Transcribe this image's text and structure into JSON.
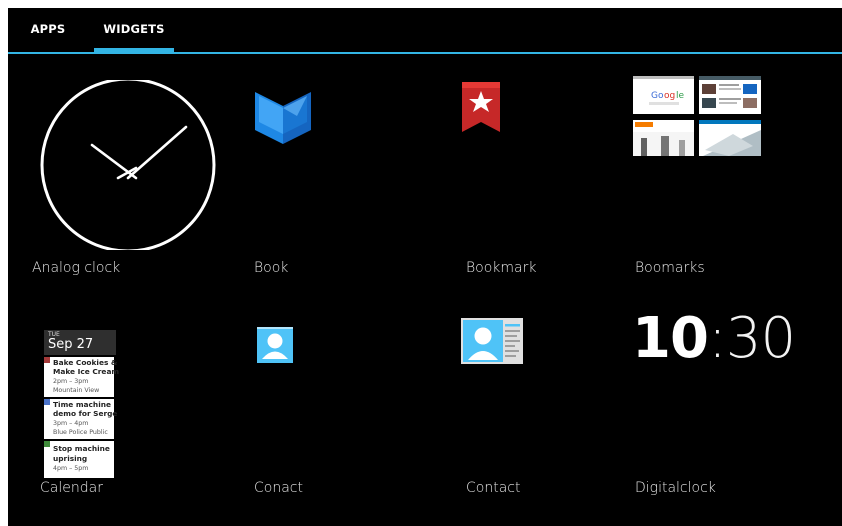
{
  "tabs": [
    {
      "label": "APPS",
      "active": false
    },
    {
      "label": "WIDGETS",
      "active": true
    }
  ],
  "accent_color": "#33b5e5",
  "widgets": [
    {
      "label": "Analog clock",
      "icon": "analog-clock-icon"
    },
    {
      "label": "Book",
      "icon": "book-icon"
    },
    {
      "label": "Bookmark",
      "icon": "bookmark-icon"
    },
    {
      "label": "Boomarks",
      "icon": "bookmarks-thumbnails-icon"
    },
    {
      "label": "Calendar",
      "icon": "calendar-preview"
    },
    {
      "label": "Conact",
      "icon": "contact-icon"
    },
    {
      "label": "Contact",
      "icon": "contact-card-icon"
    },
    {
      "label": "Digitalclock",
      "icon": "digital-clock-preview"
    }
  ],
  "calendar_preview": {
    "day": "TUE",
    "date": "Sep 27",
    "events": [
      {
        "title1": "Bake Cookies &",
        "title2": "Make Ice Cream",
        "time": "2pm – 3pm",
        "place": "Mountain View",
        "color": "#a43a3a"
      },
      {
        "title1": "Time machine",
        "title2": "demo for Serge",
        "time": "3pm – 4pm",
        "place": "Blue Police Public",
        "color": "#4a72c8"
      },
      {
        "title1": "Stop machine",
        "title2": "uprising",
        "time": "4pm – 5pm",
        "place": "",
        "color": "#3f8a3a"
      }
    ]
  },
  "digital_clock": {
    "hours": "10",
    "separator": ":",
    "minutes": "30"
  }
}
